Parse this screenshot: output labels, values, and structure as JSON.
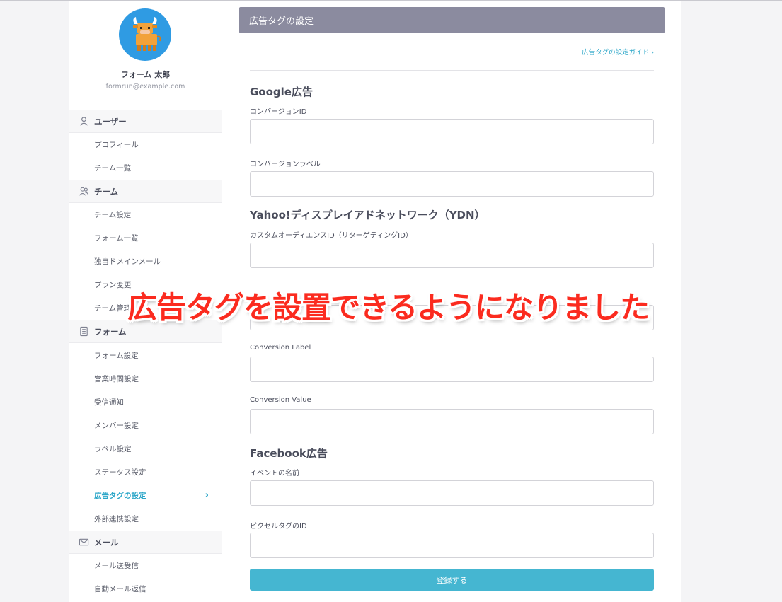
{
  "profile": {
    "name": "フォーム 太郎",
    "email": "formrun@example.com"
  },
  "sidebar": {
    "sections": [
      {
        "title": "ユーザー",
        "icon": "user-icon"
      },
      {
        "title": "チーム",
        "icon": "team-icon"
      },
      {
        "title": "フォーム",
        "icon": "document-icon"
      },
      {
        "title": "メール",
        "icon": "mail-icon"
      }
    ],
    "items": [
      "プロフィール",
      "チーム一覧",
      "チーム設定",
      "フォーム一覧",
      "独自ドメインメール",
      "プラン変更",
      "チーム管理",
      "フォーム設定",
      "営業時間設定",
      "受信通知",
      "メンバー設定",
      "ラベル設定",
      "ステータス設定",
      "広告タグの設定",
      "外部連携設定",
      "メール送受信",
      "自動メール返信"
    ],
    "active_item": "広告タグの設定"
  },
  "main": {
    "header": "広告タグの設定",
    "guide_link": "広告タグの設定ガイド ›",
    "google": {
      "title": "Google広告",
      "conversion_id_label": "コンバージョンID",
      "conversion_label_label": "コンバージョンラベル"
    },
    "ydn": {
      "title": "Yahoo!ディスプレイアドネットワーク（YDN）",
      "custom_audience_label": "カスタムオーディエンスID（リターゲティングID）",
      "conversion_label": "Conversion Label",
      "conversion_value": "Conversion Value"
    },
    "facebook": {
      "title": "Facebook広告",
      "event_name_label": "イベントの名前",
      "pixel_id_label": "ピクセルタグのID"
    },
    "submit": "登録する"
  },
  "banner": "広告タグを設置できるようになりました",
  "colors": {
    "accent": "#2ba6c8",
    "button": "#45b6d1",
    "header": "#8b8b9f",
    "banner": "#fb2b1f"
  }
}
